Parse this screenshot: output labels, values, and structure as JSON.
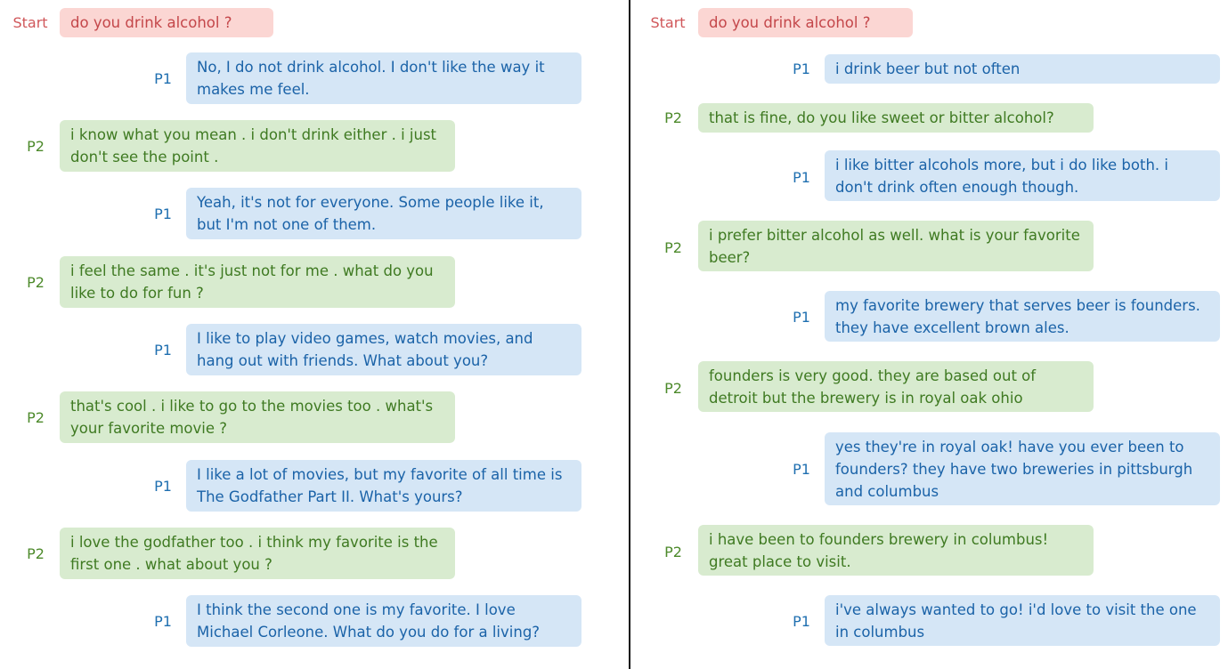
{
  "left": {
    "messages": [
      {
        "speaker": "Start",
        "role": "start",
        "text": "do you drink alcohol ?"
      },
      {
        "speaker": "P1",
        "role": "p1",
        "text": "No, I do not drink alcohol. I don't like the way it makes me feel."
      },
      {
        "speaker": "P2",
        "role": "p2",
        "text": "i know what you mean . i don't drink either . i just don't see the point ."
      },
      {
        "speaker": "P1",
        "role": "p1",
        "text": "Yeah, it's not for everyone. Some people like it, but I'm not one of them."
      },
      {
        "speaker": "P2",
        "role": "p2",
        "text": "i feel the same . it's just not for me . what do you like to do for fun ?"
      },
      {
        "speaker": "P1",
        "role": "p1",
        "text": "I like to play video games, watch movies, and hang out with friends. What about you?"
      },
      {
        "speaker": "P2",
        "role": "p2",
        "text": "that's cool . i like to go to the movies too . what's your favorite movie ?"
      },
      {
        "speaker": "P1",
        "role": "p1",
        "text": "I like a lot of movies, but my favorite of all time is The Godfather Part II. What's yours?"
      },
      {
        "speaker": "P2",
        "role": "p2",
        "text": "i love the godfather too . i think my favorite is the first one . what about you ?"
      },
      {
        "speaker": "P1",
        "role": "p1",
        "text": "I think the second one is my favorite. I love Michael Corleone. What do you do for a living?"
      }
    ]
  },
  "right": {
    "messages": [
      {
        "speaker": "Start",
        "role": "start",
        "text": "do you drink alcohol ?"
      },
      {
        "speaker": "P1",
        "role": "p1",
        "text": "i drink beer but not often"
      },
      {
        "speaker": "P2",
        "role": "p2",
        "text": "that is fine, do you like sweet or bitter alcohol?"
      },
      {
        "speaker": "P1",
        "role": "p1",
        "text": "i like bitter alcohols more, but i do like both. i don't drink often enough though."
      },
      {
        "speaker": "P2",
        "role": "p2",
        "text": "i prefer bitter alcohol as well. what is your favorite beer?"
      },
      {
        "speaker": "P1",
        "role": "p1",
        "text": "my favorite brewery that serves beer is founders. they have excellent brown ales."
      },
      {
        "speaker": "P2",
        "role": "p2",
        "text": "founders is very good. they are based out of detroit but the brewery is in royal oak ohio"
      },
      {
        "speaker": "P1",
        "role": "p1",
        "text": "yes they're in royal oak! have you ever been to founders? they have two breweries in pittsburgh and columbus"
      },
      {
        "speaker": "P2",
        "role": "p2",
        "text": "i have been to founders brewery in columbus! great place to visit."
      },
      {
        "speaker": "P1",
        "role": "p1",
        "text": "i've always wanted to go! i'd love to visit the one in columbus"
      }
    ]
  },
  "colors": {
    "start_bg": "#fbd6d3",
    "start_text": "#c4474a",
    "p1_bg": "#d5e6f6",
    "p1_text": "#1b63a8",
    "p2_bg": "#d8ebcf",
    "p2_text": "#3f7a22"
  }
}
